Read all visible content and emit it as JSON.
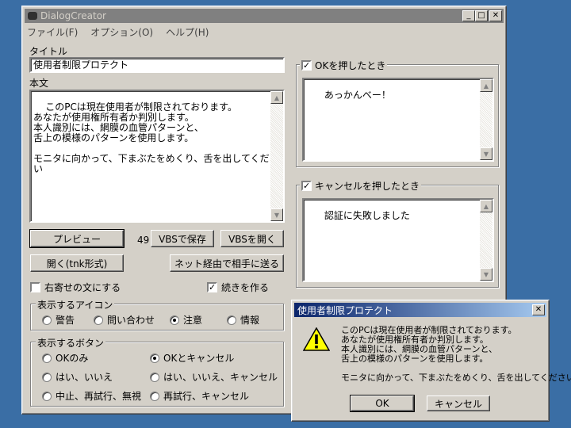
{
  "main_window": {
    "title": "DialogCreator",
    "menu": [
      "ファイル(F)",
      "オプション(O)",
      "ヘルプ(H)"
    ],
    "title_label": "タイトル",
    "title_value": "使用者制限プロテクト",
    "body_label": "本文",
    "body_text": "このPCは現在使用者が制限されております。\nあなたが使用権所有者か判別します。\n本人識別には、網膜の血管パターンと、\n舌上の模様のパターンを使用します。\n\nモニタに向かって、下まぶたをめくり、舌を出してください",
    "buttons": {
      "preview": "プレビュー",
      "count": "49",
      "save_vbs": "VBSで保存",
      "open_vbs": "VBSを開く",
      "open_tnk": "開く(tnk形式)",
      "send_net": "ネット経由で相手に送る"
    },
    "checks": {
      "right_align": {
        "label": "右寄せの文にする",
        "checked": false
      },
      "continue": {
        "label": "続きを作る",
        "checked": true
      }
    },
    "icon_group": {
      "title": "表示するアイコン",
      "options": [
        "警告",
        "問い合わせ",
        "注意",
        "情報"
      ],
      "selected": 2
    },
    "button_group": {
      "title": "表示するボタン",
      "options": [
        "OKのみ",
        "OKとキャンセル",
        "はい、いいえ",
        "はい、いいえ、キャンセル",
        "中止、再試行、無視",
        "再試行、キャンセル"
      ],
      "selected": 1
    },
    "ok_section": {
      "label": "OKを押したとき",
      "checked": true,
      "text": "あっかんべー！"
    },
    "cancel_section": {
      "label": "キャンセルを押したとき",
      "checked": true,
      "text": "認証に失敗しました"
    }
  },
  "message_box": {
    "title": "使用者制限プロテクト",
    "icon": "warning-icon",
    "text": "このPCは現在使用者が制限されております。\nあなたが使用権所有者か判別します。\n本人識別には、網膜の血管パターンと、\n舌上の模様のパターンを使用します。\n\nモニタに向かって、下まぶたをめくり、舌を出してください",
    "ok": "OK",
    "cancel": "キャンセル"
  }
}
